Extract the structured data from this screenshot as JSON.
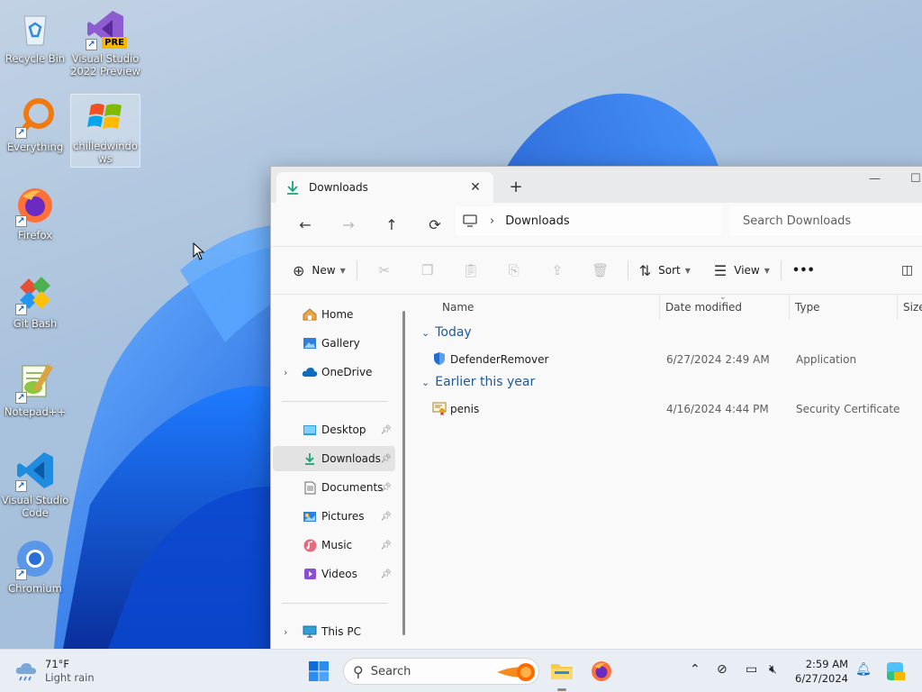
{
  "desktop": {
    "icons": [
      {
        "label": "Recycle Bin",
        "icon": "recycle-bin-icon"
      },
      {
        "label": "Visual Studio 2022 Preview",
        "icon": "visual-studio-icon",
        "badge": "PRE"
      },
      {
        "label": "Everything",
        "icon": "everything-search-icon"
      },
      {
        "label": "chilledwindows",
        "icon": "windows-xp-logo-icon"
      },
      {
        "label": "Firefox",
        "icon": "firefox-icon"
      },
      {
        "label": "Git Bash",
        "icon": "git-bash-icon"
      },
      {
        "label": "Notepad++",
        "icon": "notepadpp-icon"
      },
      {
        "label": "Visual Studio Code",
        "icon": "vscode-icon"
      },
      {
        "label": "Chromium",
        "icon": "chromium-icon"
      }
    ]
  },
  "explorer": {
    "tab_title": "Downloads",
    "breadcrumb": "Downloads",
    "search_placeholder": "Search Downloads",
    "toolbar": {
      "new_label": "New",
      "sort_label": "Sort",
      "view_label": "View",
      "more_label": "•••"
    },
    "nav": {
      "home": "Home",
      "gallery": "Gallery",
      "onedrive": "OneDrive",
      "desktop": "Desktop",
      "downloads": "Downloads",
      "documents": "Documents",
      "pictures": "Pictures",
      "music": "Music",
      "videos": "Videos",
      "this_pc": "This PC"
    },
    "columns": {
      "name": "Name",
      "date": "Date modified",
      "type": "Type",
      "size": "Size"
    },
    "groups": [
      {
        "label": "Today",
        "files": [
          {
            "name": "DefenderRemover",
            "date": "6/27/2024 2:49 AM",
            "type": "Application"
          }
        ]
      },
      {
        "label": "Earlier this year",
        "files": [
          {
            "name": "penis",
            "date": "4/16/2024 4:44 PM",
            "type": "Security Certificate"
          }
        ]
      }
    ]
  },
  "taskbar": {
    "weather_temp": "71°F",
    "weather_desc": "Light rain",
    "search_label": "Search",
    "time": "2:59 AM",
    "date": "6/27/2024"
  },
  "colors": {
    "accent": "#0067c0",
    "folder_teal": "#1aa37a"
  }
}
